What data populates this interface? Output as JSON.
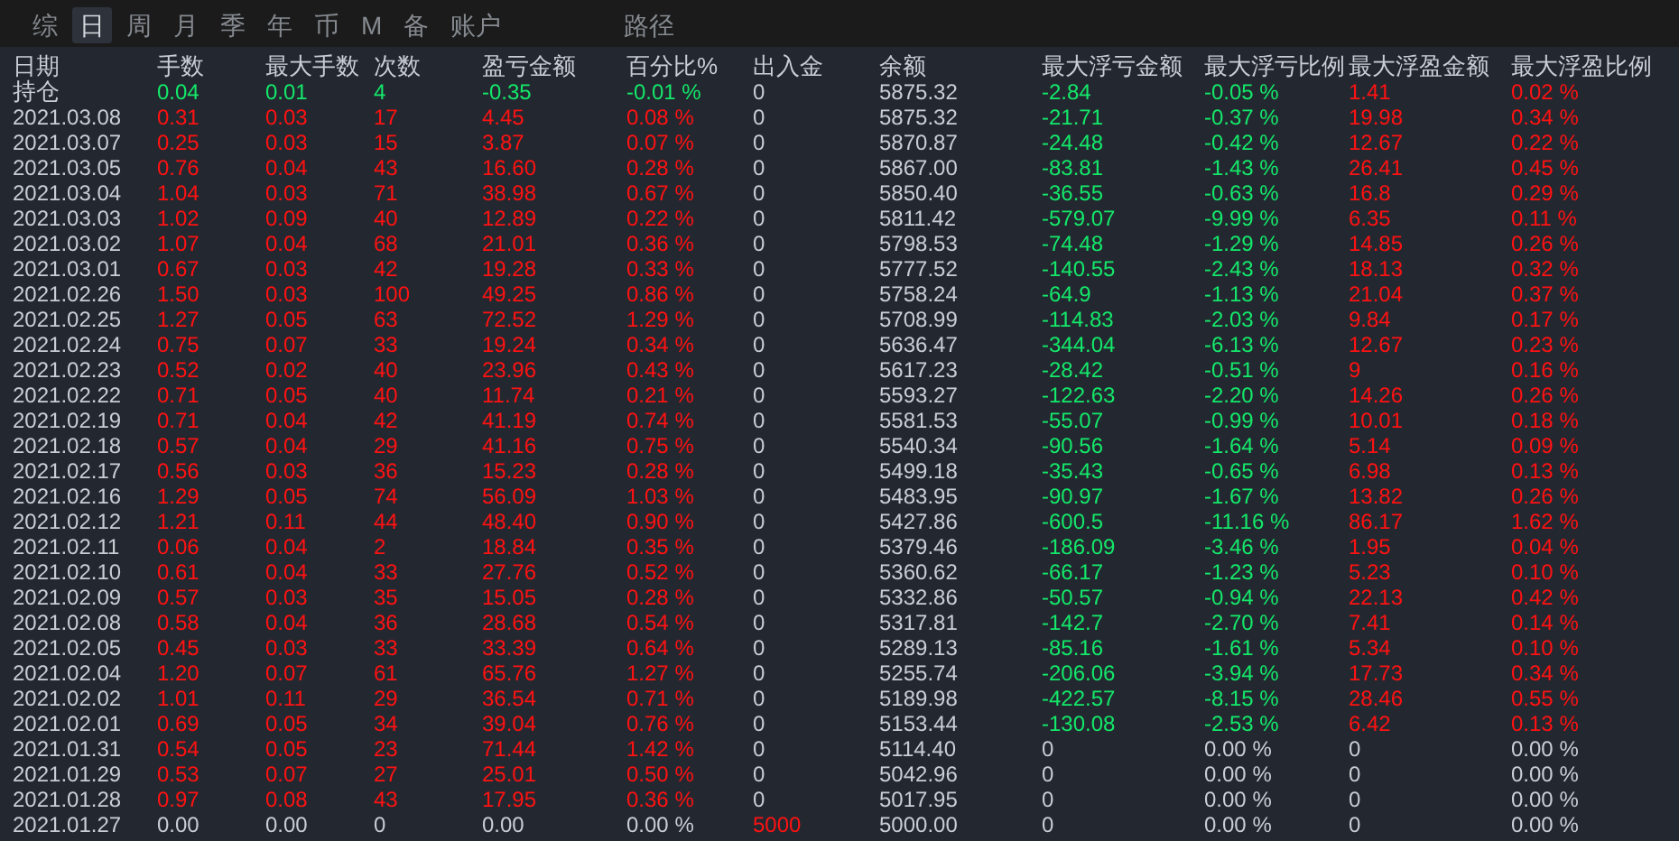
{
  "tabs": [
    {
      "label": "综",
      "selected": false
    },
    {
      "label": "日",
      "selected": true
    },
    {
      "label": "周",
      "selected": false
    },
    {
      "label": "月",
      "selected": false
    },
    {
      "label": "季",
      "selected": false
    },
    {
      "label": "年",
      "selected": false
    },
    {
      "label": "币",
      "selected": false
    },
    {
      "label": "M",
      "selected": false
    },
    {
      "label": "备",
      "selected": false
    },
    {
      "label": "账户",
      "selected": false
    }
  ],
  "path_label": "路径",
  "table": {
    "columns": [
      "日期",
      "手数",
      "最大手数",
      "次数",
      "盈亏金额",
      "百分比%",
      "出入金",
      "余额",
      "最大浮亏金额",
      "最大浮亏比例",
      "最大浮盈金额",
      "最大浮盈比例"
    ],
    "rows": [
      {
        "kind": "holding",
        "cells": [
          "持仓",
          "0.04",
          "0.01",
          "4",
          "-0.35",
          "-0.01 %",
          "0",
          "5875.32",
          "-2.84",
          "-0.05 %",
          "1.41",
          "0.02 %"
        ]
      },
      {
        "kind": "day",
        "cells": [
          "2021.03.08",
          "0.31",
          "0.03",
          "17",
          "4.45",
          "0.08 %",
          "0",
          "5875.32",
          "-21.71",
          "-0.37 %",
          "19.98",
          "0.34 %"
        ]
      },
      {
        "kind": "day",
        "cells": [
          "2021.03.07",
          "0.25",
          "0.03",
          "15",
          "3.87",
          "0.07 %",
          "0",
          "5870.87",
          "-24.48",
          "-0.42 %",
          "12.67",
          "0.22 %"
        ]
      },
      {
        "kind": "day",
        "cells": [
          "2021.03.05",
          "0.76",
          "0.04",
          "43",
          "16.60",
          "0.28 %",
          "0",
          "5867.00",
          "-83.81",
          "-1.43 %",
          "26.41",
          "0.45 %"
        ]
      },
      {
        "kind": "day",
        "cells": [
          "2021.03.04",
          "1.04",
          "0.03",
          "71",
          "38.98",
          "0.67 %",
          "0",
          "5850.40",
          "-36.55",
          "-0.63 %",
          "16.8",
          "0.29 %"
        ]
      },
      {
        "kind": "day",
        "cells": [
          "2021.03.03",
          "1.02",
          "0.09",
          "40",
          "12.89",
          "0.22 %",
          "0",
          "5811.42",
          "-579.07",
          "-9.99 %",
          "6.35",
          "0.11 %"
        ]
      },
      {
        "kind": "day",
        "cells": [
          "2021.03.02",
          "1.07",
          "0.04",
          "68",
          "21.01",
          "0.36 %",
          "0",
          "5798.53",
          "-74.48",
          "-1.29 %",
          "14.85",
          "0.26 %"
        ]
      },
      {
        "kind": "day",
        "cells": [
          "2021.03.01",
          "0.67",
          "0.03",
          "42",
          "19.28",
          "0.33 %",
          "0",
          "5777.52",
          "-140.55",
          "-2.43 %",
          "18.13",
          "0.32 %"
        ]
      },
      {
        "kind": "day",
        "cells": [
          "2021.02.26",
          "1.50",
          "0.03",
          "100",
          "49.25",
          "0.86 %",
          "0",
          "5758.24",
          "-64.9",
          "-1.13 %",
          "21.04",
          "0.37 %"
        ]
      },
      {
        "kind": "day",
        "cells": [
          "2021.02.25",
          "1.27",
          "0.05",
          "63",
          "72.52",
          "1.29 %",
          "0",
          "5708.99",
          "-114.83",
          "-2.03 %",
          "9.84",
          "0.17 %"
        ]
      },
      {
        "kind": "day",
        "cells": [
          "2021.02.24",
          "0.75",
          "0.07",
          "33",
          "19.24",
          "0.34 %",
          "0",
          "5636.47",
          "-344.04",
          "-6.13 %",
          "12.67",
          "0.23 %"
        ]
      },
      {
        "kind": "day",
        "cells": [
          "2021.02.23",
          "0.52",
          "0.02",
          "40",
          "23.96",
          "0.43 %",
          "0",
          "5617.23",
          "-28.42",
          "-0.51 %",
          "9",
          "0.16 %"
        ]
      },
      {
        "kind": "day",
        "cells": [
          "2021.02.22",
          "0.71",
          "0.05",
          "40",
          "11.74",
          "0.21 %",
          "0",
          "5593.27",
          "-122.63",
          "-2.20 %",
          "14.26",
          "0.26 %"
        ]
      },
      {
        "kind": "day",
        "cells": [
          "2021.02.19",
          "0.71",
          "0.04",
          "42",
          "41.19",
          "0.74 %",
          "0",
          "5581.53",
          "-55.07",
          "-0.99 %",
          "10.01",
          "0.18 %"
        ]
      },
      {
        "kind": "day",
        "cells": [
          "2021.02.18",
          "0.57",
          "0.04",
          "29",
          "41.16",
          "0.75 %",
          "0",
          "5540.34",
          "-90.56",
          "-1.64 %",
          "5.14",
          "0.09 %"
        ]
      },
      {
        "kind": "day",
        "cells": [
          "2021.02.17",
          "0.56",
          "0.03",
          "36",
          "15.23",
          "0.28 %",
          "0",
          "5499.18",
          "-35.43",
          "-0.65 %",
          "6.98",
          "0.13 %"
        ]
      },
      {
        "kind": "day",
        "cells": [
          "2021.02.16",
          "1.29",
          "0.05",
          "74",
          "56.09",
          "1.03 %",
          "0",
          "5483.95",
          "-90.97",
          "-1.67 %",
          "13.82",
          "0.26 %"
        ]
      },
      {
        "kind": "day",
        "cells": [
          "2021.02.12",
          "1.21",
          "0.11",
          "44",
          "48.40",
          "0.90 %",
          "0",
          "5427.86",
          "-600.5",
          "-11.16 %",
          "86.17",
          "1.62 %"
        ]
      },
      {
        "kind": "day",
        "cells": [
          "2021.02.11",
          "0.06",
          "0.04",
          "2",
          "18.84",
          "0.35 %",
          "0",
          "5379.46",
          "-186.09",
          "-3.46 %",
          "1.95",
          "0.04 %"
        ]
      },
      {
        "kind": "day",
        "cells": [
          "2021.02.10",
          "0.61",
          "0.04",
          "33",
          "27.76",
          "0.52 %",
          "0",
          "5360.62",
          "-66.17",
          "-1.23 %",
          "5.23",
          "0.10 %"
        ]
      },
      {
        "kind": "day",
        "cells": [
          "2021.02.09",
          "0.57",
          "0.03",
          "35",
          "15.05",
          "0.28 %",
          "0",
          "5332.86",
          "-50.57",
          "-0.94 %",
          "22.13",
          "0.42 %"
        ]
      },
      {
        "kind": "day",
        "cells": [
          "2021.02.08",
          "0.58",
          "0.04",
          "36",
          "28.68",
          "0.54 %",
          "0",
          "5317.81",
          "-142.7",
          "-2.70 %",
          "7.41",
          "0.14 %"
        ]
      },
      {
        "kind": "day",
        "cells": [
          "2021.02.05",
          "0.45",
          "0.03",
          "33",
          "33.39",
          "0.64 %",
          "0",
          "5289.13",
          "-85.16",
          "-1.61 %",
          "5.34",
          "0.10 %"
        ]
      },
      {
        "kind": "day",
        "cells": [
          "2021.02.04",
          "1.20",
          "0.07",
          "61",
          "65.76",
          "1.27 %",
          "0",
          "5255.74",
          "-206.06",
          "-3.94 %",
          "17.73",
          "0.34 %"
        ]
      },
      {
        "kind": "day",
        "cells": [
          "2021.02.02",
          "1.01",
          "0.11",
          "29",
          "36.54",
          "0.71 %",
          "0",
          "5189.98",
          "-422.57",
          "-8.15 %",
          "28.46",
          "0.55 %"
        ]
      },
      {
        "kind": "day",
        "cells": [
          "2021.02.01",
          "0.69",
          "0.05",
          "34",
          "39.04",
          "0.76 %",
          "0",
          "5153.44",
          "-130.08",
          "-2.53 %",
          "6.42",
          "0.13 %"
        ]
      },
      {
        "kind": "day_flat",
        "cells": [
          "2021.01.31",
          "0.54",
          "0.05",
          "23",
          "71.44",
          "1.42 %",
          "0",
          "5114.40",
          "0",
          "0.00 %",
          "0",
          "0.00 %"
        ]
      },
      {
        "kind": "day_flat",
        "cells": [
          "2021.01.29",
          "0.53",
          "0.07",
          "27",
          "25.01",
          "0.50 %",
          "0",
          "5042.96",
          "0",
          "0.00 %",
          "0",
          "0.00 %"
        ]
      },
      {
        "kind": "day_flat",
        "cells": [
          "2021.01.28",
          "0.97",
          "0.08",
          "43",
          "17.95",
          "0.36 %",
          "0",
          "5017.95",
          "0",
          "0.00 %",
          "0",
          "0.00 %"
        ]
      },
      {
        "kind": "deposit",
        "cells": [
          "2021.01.27",
          "0.00",
          "0.00",
          "0",
          "0.00",
          "0.00 %",
          "5000",
          "5000.00",
          "0",
          "0.00 %",
          "0",
          "0.00 %"
        ]
      }
    ]
  }
}
